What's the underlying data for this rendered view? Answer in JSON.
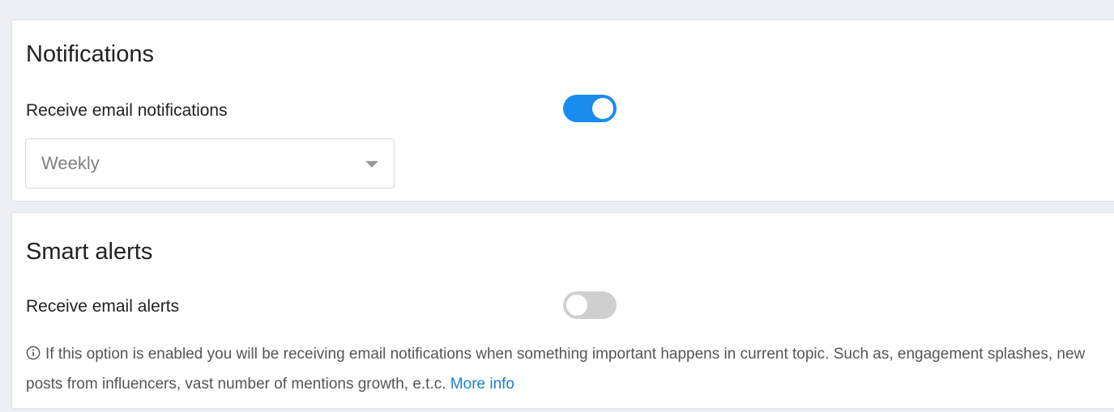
{
  "notifications": {
    "title": "Notifications",
    "email_label": "Receive email notifications",
    "email_toggle_on": true,
    "frequency_value": "Weekly"
  },
  "smart_alerts": {
    "title": "Smart alerts",
    "email_label": "Receive email alerts",
    "email_toggle_on": false,
    "info_text": "If this option is enabled you will be receiving email notifications when something important happens in current topic. Such as, engagement splashes, new posts from influencers, vast number of mentions growth, e.t.c.",
    "more_info_link": "More info"
  },
  "colors": {
    "accent": "#1a8cf0",
    "toggle_off": "#cfcfcf",
    "link": "#1a7fd6",
    "page_background": "#eceff3"
  },
  "icons": {
    "info": "info-circle-icon",
    "dropdown": "caret-down-icon"
  }
}
